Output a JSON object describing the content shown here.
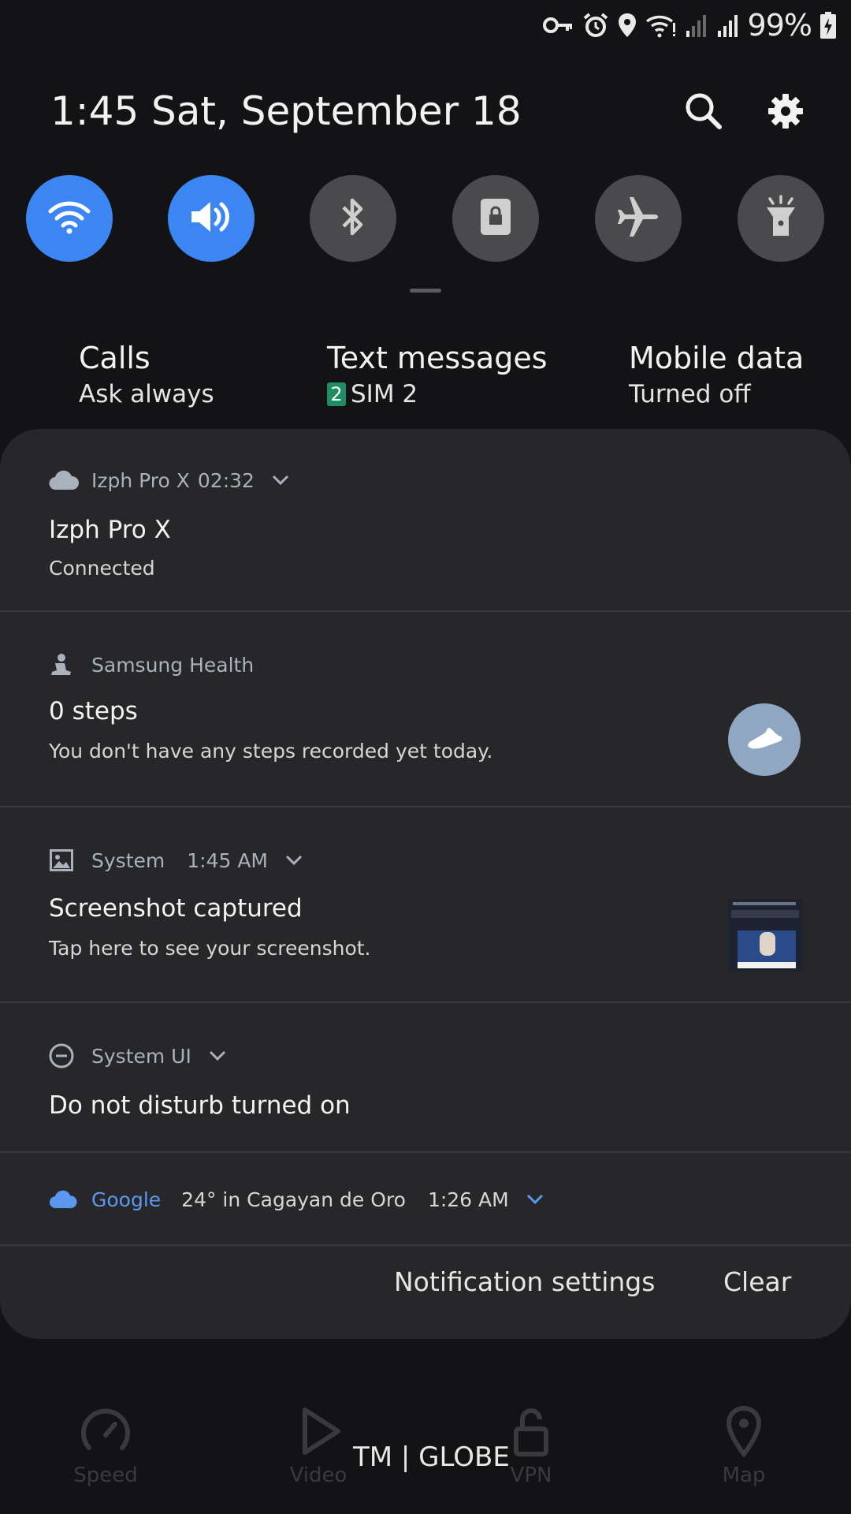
{
  "status_bar": {
    "battery_percent": "99%",
    "icons": [
      "vpn-key-icon",
      "alarm-icon",
      "location-icon",
      "wifi-icon",
      "signal-1-icon",
      "signal-2-icon",
      "battery-charging-icon"
    ]
  },
  "header": {
    "time": "1:45",
    "date": "Sat, September 18",
    "search_icon": "search-icon",
    "settings_icon": "gear-icon"
  },
  "quick_toggles": [
    {
      "name": "wifi",
      "icon": "wifi-icon",
      "state": "on"
    },
    {
      "name": "sound",
      "icon": "volume-icon",
      "state": "on"
    },
    {
      "name": "bluetooth",
      "icon": "bluetooth-icon",
      "state": "off"
    },
    {
      "name": "screen-lock",
      "icon": "lock-rotation-icon",
      "state": "off"
    },
    {
      "name": "airplane-mode",
      "icon": "airplane-icon",
      "state": "off"
    },
    {
      "name": "flashlight",
      "icon": "flashlight-icon",
      "state": "off"
    }
  ],
  "sim_info": {
    "calls": {
      "title": "Calls",
      "subtitle": "Ask always"
    },
    "text_messages": {
      "title": "Text messages",
      "badge": "2",
      "subtitle": "SIM 2"
    },
    "mobile_data": {
      "title": "Mobile data",
      "subtitle": "Turned off"
    }
  },
  "notifications": [
    {
      "app": "Izph Pro X",
      "time": "02:32",
      "title": "Izph Pro X",
      "text": "Connected",
      "icon": "cloud-icon"
    },
    {
      "app": "Samsung Health",
      "time": "",
      "title": "0 steps",
      "text": "You don't have any steps recorded yet today.",
      "icon": "health-icon",
      "action_icon": "shoe-icon"
    },
    {
      "app": "System",
      "time": "1:45 AM",
      "title": "Screenshot captured",
      "text": "Tap here to see your screenshot.",
      "icon": "image-icon"
    },
    {
      "app": "System UI",
      "time": "",
      "title": "Do not disturb turned on",
      "text": "",
      "icon": "do-not-disturb-icon"
    },
    {
      "app": "Google",
      "detail": "24° in Cagayan de Oro",
      "time": "1:26 AM",
      "icon": "weather-cloud-icon"
    }
  ],
  "panel_actions": {
    "notification_settings": "Notification settings",
    "clear": "Clear"
  },
  "bottom_nav": {
    "carrier": "TM | GLOBE",
    "items": [
      {
        "label": "Speed",
        "icon": "speedometer-icon"
      },
      {
        "label": "Video",
        "icon": "play-icon"
      },
      {
        "label": "VPN",
        "icon": "lock-icon"
      },
      {
        "label": "Map",
        "icon": "map-pin-icon"
      }
    ]
  },
  "colors": {
    "accent": "#3b86f3",
    "panel": "#272729",
    "background": "#131315",
    "google_blue": "#5b97f0"
  }
}
